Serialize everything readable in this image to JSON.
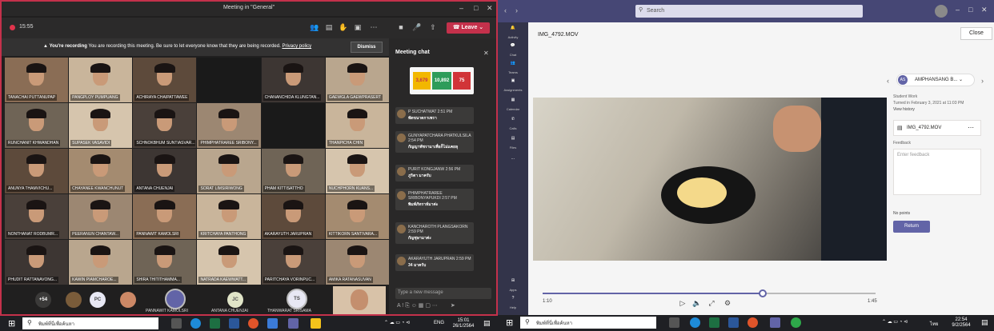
{
  "left": {
    "title": "Meeting in \"General\"",
    "timer": "15:55",
    "leave_label": "Leave",
    "banner": {
      "bold": "You're recording",
      "text": "You are recording this meeting. Be sure to let everyone know that they are being recorded.",
      "link": "Privacy policy",
      "dismiss": "Dismiss"
    },
    "participants": [
      "TANACHAI PUTTANUPAP",
      "PANGPLOY PUMPUANG",
      "ACHIRAYA CHAIPATTAWEE",
      "",
      "CHANANCHIDA KLUNGTAN...",
      "GAEWGLA GAEWPRASERT",
      "RUNCHANIT KHWANDHAN",
      "SUPASEK VASAVIDI",
      "SCHNOKBHUM SUNTIASVAR...",
      "PHIMPHATRAREE SRIBONY...",
      "",
      "THANPICHA CHIN",
      "ANUNYA THAMVICHU...",
      "CHAYANEE KWANCHUNUT",
      "ANTANA CHUENJAI",
      "SORAT LIMSIRIWONG",
      "PHAM KITTISATTHO",
      "NUCHPHORN KUANS...",
      "NONTHANAT RODBUMR...",
      "PEERANUN CHANTAW...",
      "PANNAWIT KAMOLSRI",
      "KRITCHAYA PANTHONG",
      "AKARAYUTH JARUPRAN",
      "KITTIKORN SANTIVARA...",
      "PHUDIT RATTANAVONG...",
      "KAWIN PIAMCHAROE...",
      "SHIRA THITITHAMMA...",
      "NATRADA KAEWWATT...",
      "PARITCHAYA VORINPUC...",
      "AMIKA RATANASUVAN"
    ],
    "strip": {
      "more": "+54",
      "pc": "PC",
      "jc": "JC",
      "ts": "TS",
      "name1": "PANNAWIT KAMOLSRI",
      "name2": "ANTANA CHUENJAI",
      "name3": "THANWARAT SRISAMA"
    },
    "chat": {
      "header": "Meeting chat",
      "stats": [
        "3,679",
        "10,892",
        "75"
      ],
      "messages": [
        {
          "name": "P SUCHATWAT",
          "time": "2:51 PM",
          "text": "พัดขนาดกาเพรา"
        },
        {
          "name": "GUNYAPATCHARA PHATKULSILA",
          "time": "2:54 PM",
          "text": "กัญญาพัชรามาเพื่อก็ไม่แคยลุ"
        },
        {
          "name": "PURIT KONGJANW",
          "time": "2:56 PM",
          "text": "ภูริตา มาครับ"
        },
        {
          "name": "PHIMPHATRAREE SRIBONYAPUKDI",
          "time": "2:57 PM",
          "text": "พิมพ์ภัทราห์มาค่ะ"
        },
        {
          "name": "KANCHAROTH PLANGSAKORN",
          "time": "2:59 PM",
          "text": "กัญชุษามาค่ะ"
        },
        {
          "name": "AKARAYUTH JARUPRAN",
          "time": "2:59 PM",
          "text": "34 มาครับ"
        }
      ],
      "new_message": "Type a new message"
    },
    "taskbar": {
      "search": "พิมพ์ที่นี่เพื่อค้นหา",
      "lang": "ENG",
      "time": "15:01",
      "date": "26/1/2564"
    }
  },
  "right": {
    "search": "Search",
    "rail": [
      "Activity",
      "Chat",
      "Teams",
      "Assignments",
      "Calendar",
      "Calls",
      "Files",
      "Apps",
      "Help"
    ],
    "video_title": "IMG_4792.MOV",
    "close": "Close",
    "student_initials": "AS",
    "student_name": "AMPHANSANG B...",
    "student_work": "Student Work",
    "turned_in": "Turned in February 3, 2021 at 11:03 PM",
    "view_history": "View history",
    "file_name": "IMG_4792.MOV",
    "feedback_label": "Feedback",
    "feedback_placeholder": "Enter feedback",
    "points": "No points",
    "return": "Return",
    "time_current": "1:10",
    "time_total": "1:45",
    "progress_fraction": 0.66,
    "taskbar": {
      "search": "พิมพ์ที่นี่เพื่อค้นหา",
      "lang": "ไทย",
      "time": "22:54",
      "date": "9/2/2564"
    }
  }
}
